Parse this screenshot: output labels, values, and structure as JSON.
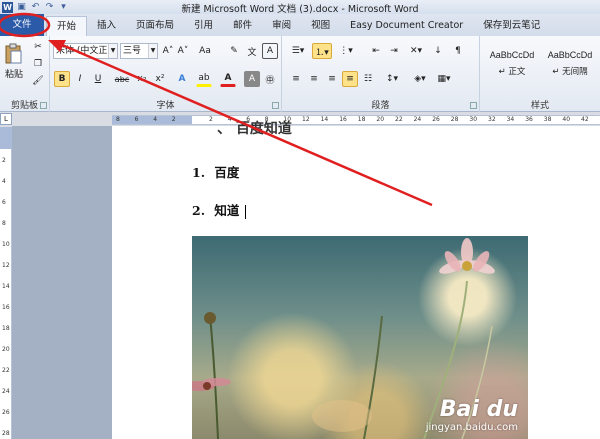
{
  "window": {
    "title": "新建 Microsoft Word 文档 (3).docx - Microsoft Word"
  },
  "quick_access": {
    "icons": [
      "word-icon",
      "save-icon",
      "undo-icon",
      "redo-icon",
      "customize-icon"
    ],
    "word_glyph": "W",
    "save_glyph": "▣",
    "undo_glyph": "↶",
    "redo_glyph": "↷",
    "customize_glyph": "▾"
  },
  "tabs": [
    {
      "label": "文件"
    },
    {
      "label": "开始"
    },
    {
      "label": "插入"
    },
    {
      "label": "页面布局"
    },
    {
      "label": "引用"
    },
    {
      "label": "邮件"
    },
    {
      "label": "审阅"
    },
    {
      "label": "视图"
    },
    {
      "label": "Easy Document Creator"
    },
    {
      "label": "保存到云笔记"
    }
  ],
  "ribbon": {
    "clipboard": {
      "label": "剪贴板",
      "paste": "粘贴"
    },
    "font": {
      "label": "字体",
      "font_name": "宋体 (中文正",
      "font_size": "三号",
      "grow": "A˄",
      "shrink": "A˅",
      "change_case": "Aa",
      "clear": "✎",
      "phonetic": "文",
      "border_char": "A",
      "bold": "B",
      "italic": "I",
      "underline": "U",
      "strike": "abc",
      "subscript": "x₂",
      "superscript": "x²",
      "effects": "A",
      "highlight": "ab",
      "font_color": "A",
      "shading": "A",
      "enclose": "㊥"
    },
    "paragraph": {
      "label": "段落"
    },
    "styles": {
      "label": "样式",
      "items": [
        {
          "sample": "AaBbCcDd",
          "name": "↵ 正文"
        },
        {
          "sample": "AaBbCcDd",
          "name": "↵ 无间隔"
        }
      ]
    }
  },
  "ruler": {
    "h_ticks": [
      "8",
      "6",
      "4",
      "2",
      "",
      "2",
      "4",
      "6",
      "8",
      "10",
      "12",
      "14",
      "16",
      "18",
      "20",
      "22",
      "24",
      "26",
      "28",
      "30",
      "32",
      "34",
      "36",
      "38",
      "40",
      "42",
      "44"
    ],
    "v_ticks": [
      "2",
      "4",
      "6",
      "8",
      "10",
      "12",
      "14",
      "16",
      "18",
      "20",
      "22",
      "24",
      "26",
      "28"
    ],
    "corner_glyph": "L"
  },
  "document": {
    "heading_partial": "、 百度知道",
    "items": [
      {
        "num": "1.",
        "text": "百度"
      },
      {
        "num": "2.",
        "text": "知道"
      }
    ]
  },
  "watermark": {
    "main": "Bai du",
    "sub": "jingyan.baidu.com"
  },
  "colors": {
    "file_tab": "#2a5aa8",
    "annotation": "#e02020"
  }
}
